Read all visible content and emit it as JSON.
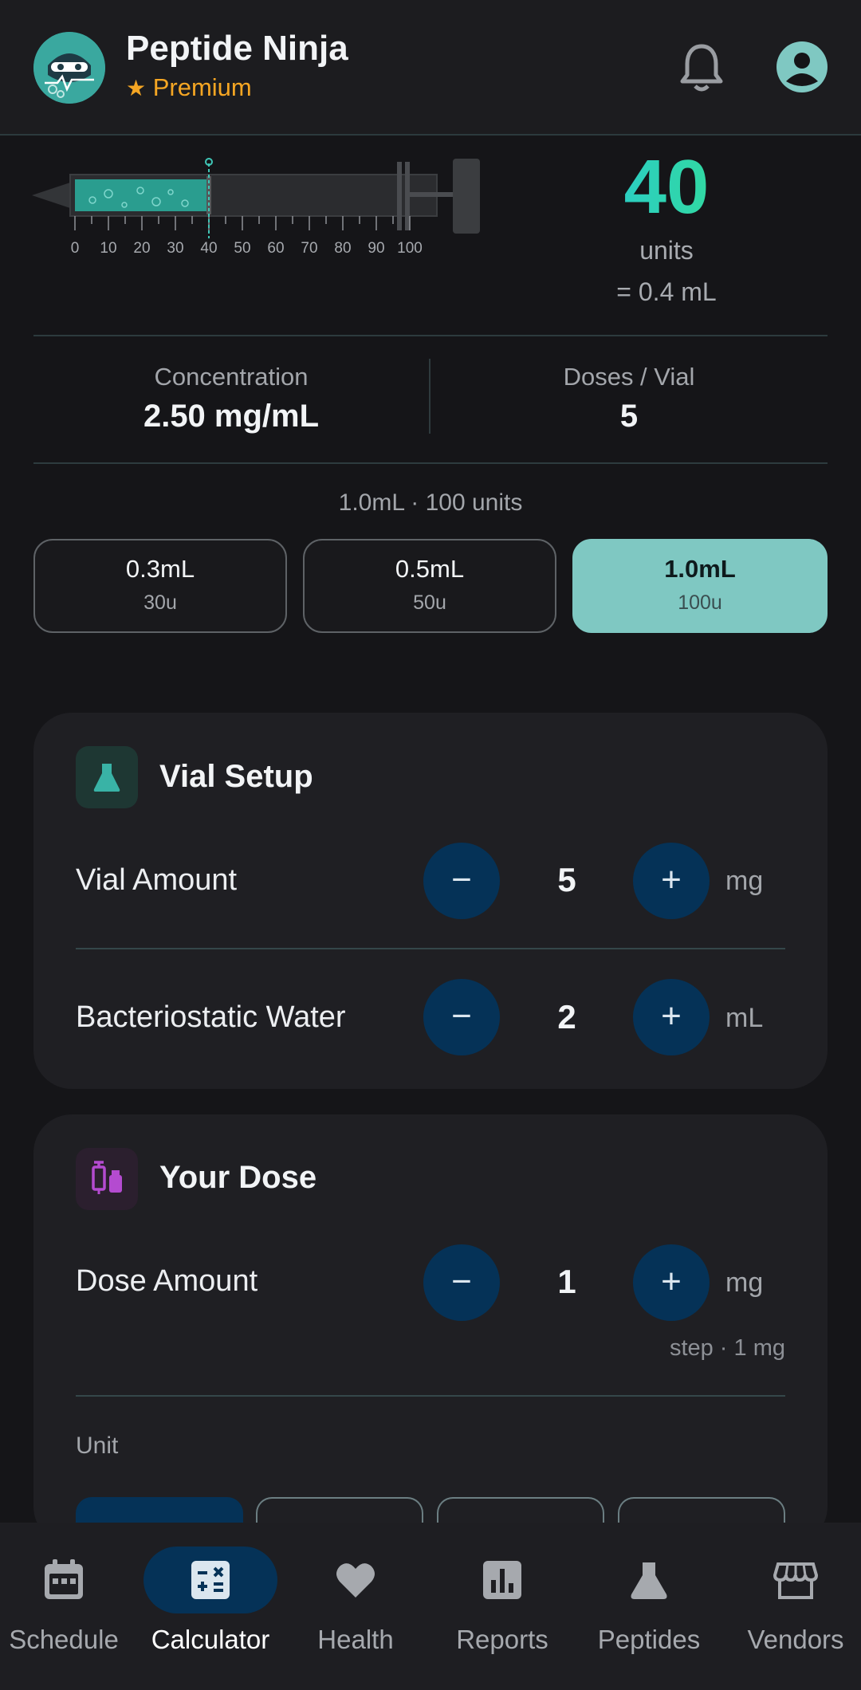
{
  "header": {
    "app_title": "Peptide Ninja",
    "premium_label": "Premium",
    "premium_icon": "star-icon",
    "bell_icon": "bell-icon",
    "avatar_icon": "account-icon"
  },
  "syringe": {
    "ticks": [
      "0",
      "10",
      "20",
      "30",
      "40",
      "50",
      "60",
      "70",
      "80",
      "90",
      "100"
    ],
    "fill_units": 40,
    "max_units": 100
  },
  "result": {
    "units_value": "40",
    "units_label": "units",
    "ml_equivalent": "= 0.4 mL"
  },
  "stats": {
    "concentration_label": "Concentration",
    "concentration_value": "2.50 mg/mL",
    "doses_label": "Doses / Vial",
    "doses_value": "5"
  },
  "syringe_size": {
    "caption": "1.0mL · 100 units",
    "options": [
      {
        "label": "0.3mL",
        "units": "30u",
        "selected": false
      },
      {
        "label": "0.5mL",
        "units": "50u",
        "selected": false
      },
      {
        "label": "1.0mL",
        "units": "100u",
        "selected": true
      }
    ]
  },
  "vial_setup": {
    "title": "Vial Setup",
    "icon": "flask-icon",
    "rows": [
      {
        "label": "Vial Amount",
        "value": "5",
        "unit": "mg",
        "minus": "−",
        "plus": "+"
      },
      {
        "label": "Bacteriostatic Water",
        "value": "2",
        "unit": "mL",
        "minus": "−",
        "plus": "+"
      }
    ]
  },
  "your_dose": {
    "title": "Your Dose",
    "icon": "syringe-vial-icon",
    "dose_label": "Dose Amount",
    "dose_value": "1",
    "dose_unit": "mg",
    "minus": "−",
    "plus": "+",
    "step_hint": "step · 1 mg",
    "unit_section_label": "Unit"
  },
  "nav": {
    "items": [
      {
        "label": "Schedule",
        "icon": "calendar-icon",
        "active": false
      },
      {
        "label": "Calculator",
        "icon": "calculator-icon",
        "active": true
      },
      {
        "label": "Health",
        "icon": "heart-icon",
        "active": false
      },
      {
        "label": "Reports",
        "icon": "bar-chart-icon",
        "active": false
      },
      {
        "label": "Peptides",
        "icon": "flask-icon",
        "active": false
      },
      {
        "label": "Vendors",
        "icon": "store-icon",
        "active": false
      }
    ]
  },
  "colors": {
    "accent_teal": "#7fc8c2",
    "stepper_blue": "#053257",
    "premium_orange": "#f5a623",
    "liquid_fill": "#2a9d8f"
  }
}
